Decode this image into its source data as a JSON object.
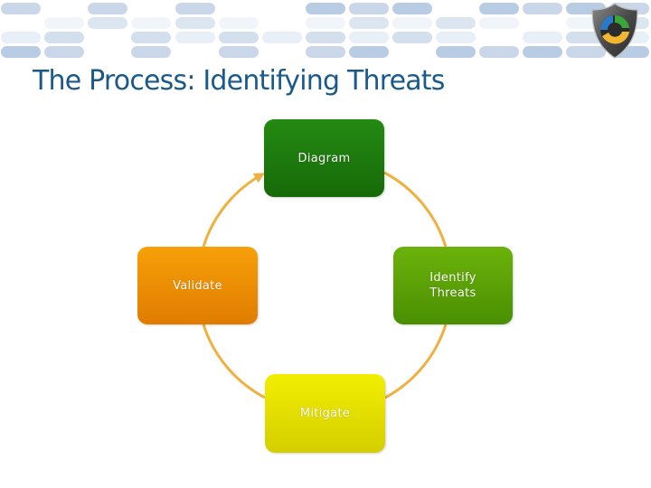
{
  "slide": {
    "title": "The Process: Identifying Threats",
    "logo_icon": "shield-cycle-icon"
  },
  "diagram": {
    "type": "cycle",
    "connector_color": "#f0b040",
    "nodes": [
      {
        "id": "diagram",
        "label": "Diagram",
        "color": "#1e7a0e"
      },
      {
        "id": "identify",
        "label": "Identify\nThreats",
        "color": "#5fa204"
      },
      {
        "id": "mitigate",
        "label": "Mitigate",
        "color": "#e6e000"
      },
      {
        "id": "validate",
        "label": "Validate",
        "color": "#ef8e00"
      }
    ],
    "edges": [
      {
        "from": "diagram",
        "to": "identify",
        "arrow": false
      },
      {
        "from": "identify",
        "to": "mitigate",
        "arrow": false
      },
      {
        "from": "mitigate",
        "to": "validate",
        "arrow": false
      },
      {
        "from": "validate",
        "to": "diagram",
        "arrow": true
      }
    ]
  }
}
